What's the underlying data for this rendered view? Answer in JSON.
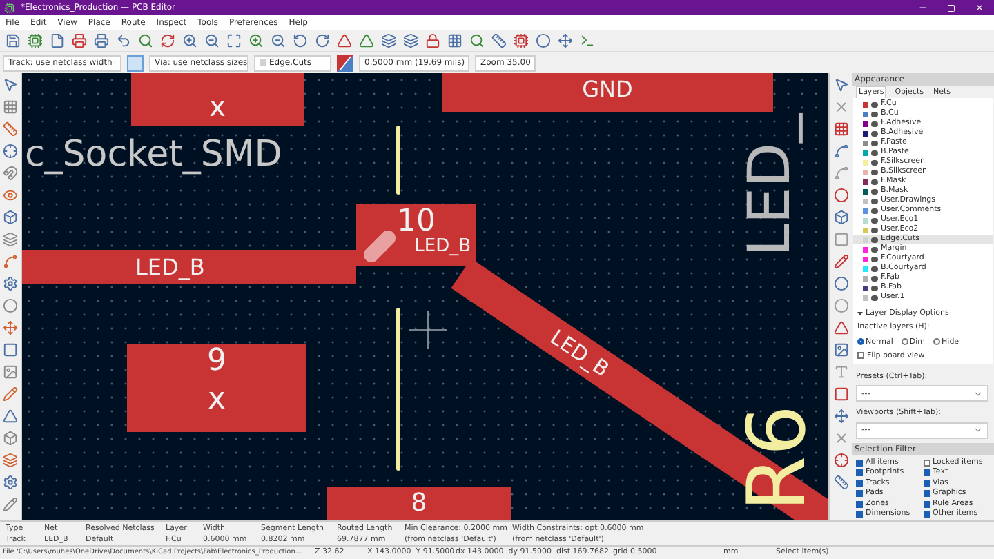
{
  "window": {
    "title": "*Electronics_Production — PCB Editor"
  },
  "menu": [
    "File",
    "Edit",
    "View",
    "Place",
    "Route",
    "Inspect",
    "Tools",
    "Preferences",
    "Help"
  ],
  "options_bar": {
    "track_width": "Track: use netclass width",
    "via_size": "Via: use netclass sizes",
    "layer": "Edge.Cuts",
    "grid": "0.5000 mm (19.69 mils)",
    "zoom": "Zoom 35.00"
  },
  "canvas": {
    "footprint_text": "c_Socket_SMD",
    "pads": [
      {
        "label": "x"
      },
      {
        "label": "GND"
      },
      {
        "label": "10",
        "net": "LED_B"
      },
      {
        "label": "9",
        "sublabel": "x"
      },
      {
        "label": "8"
      }
    ],
    "tracks": [
      {
        "net": "LED_B"
      },
      {
        "net": "LED_B"
      }
    ],
    "texts": [
      {
        "text": "LED_",
        "kind": "fab"
      },
      {
        "text": "R6",
        "kind": "silkscreen"
      }
    ]
  },
  "appearance": {
    "title": "Appearance",
    "tabs": [
      {
        "label": "Layers",
        "selected": true
      },
      {
        "label": "Objects",
        "selected": false
      },
      {
        "label": "Nets",
        "selected": false
      }
    ],
    "layers": [
      {
        "name": "F.Cu",
        "color": "#c83434",
        "selected": false
      },
      {
        "name": "B.Cu",
        "color": "#4d7fc4",
        "selected": false
      },
      {
        "name": "F.Adhesive",
        "color": "#84008a",
        "selected": false
      },
      {
        "name": "B.Adhesive",
        "color": "#1a1a7a",
        "selected": false
      },
      {
        "name": "F.Paste",
        "color": "#8c8c8c",
        "selected": false
      },
      {
        "name": "B.Paste",
        "color": "#00a8a8",
        "selected": false
      },
      {
        "name": "F.Silkscreen",
        "color": "#f2eda1",
        "selected": false
      },
      {
        "name": "B.Silkscreen",
        "color": "#e8b2a7",
        "selected": false
      },
      {
        "name": "F.Mask",
        "color": "#842b5c",
        "selected": false
      },
      {
        "name": "B.Mask",
        "color": "#025c5c",
        "selected": false
      },
      {
        "name": "User.Drawings",
        "color": "#c2c2c2",
        "selected": false
      },
      {
        "name": "User.Comments",
        "color": "#5994dc",
        "selected": false
      },
      {
        "name": "User.Eco1",
        "color": "#b5dbd2",
        "selected": false
      },
      {
        "name": "User.Eco2",
        "color": "#d8c852",
        "selected": false
      },
      {
        "name": "Edge.Cuts",
        "color": "#d0d2cd",
        "selected": true
      },
      {
        "name": "Margin",
        "color": "#ff26e2",
        "selected": false
      },
      {
        "name": "F.Courtyard",
        "color": "#ff26e2",
        "selected": false
      },
      {
        "name": "B.Courtyard",
        "color": "#26e9ff",
        "selected": false
      },
      {
        "name": "F.Fab",
        "color": "#afafaf",
        "selected": false
      },
      {
        "name": "B.Fab",
        "color": "#424280",
        "selected": false
      },
      {
        "name": "User.1",
        "color": "#c2c2c2",
        "selected": false
      }
    ],
    "display_options": {
      "header": "Layer Display Options",
      "expanded": true,
      "inactive_label": "Inactive layers (H):",
      "modes": [
        {
          "label": "Normal",
          "selected": true
        },
        {
          "label": "Dim",
          "selected": false
        },
        {
          "label": "Hide",
          "selected": false
        }
      ],
      "flip": {
        "label": "Flip board view",
        "checked": false
      }
    },
    "presets": {
      "label": "Presets (Ctrl+Tab):",
      "value": "---"
    },
    "viewports": {
      "label": "Viewports (Shift+Tab):",
      "value": "---"
    }
  },
  "selection_filter": {
    "title": "Selection Filter",
    "items": [
      {
        "label": "All items",
        "checked": true
      },
      {
        "label": "Locked items",
        "checked": false
      },
      {
        "label": "Footprints",
        "checked": true
      },
      {
        "label": "Text",
        "checked": true
      },
      {
        "label": "Tracks",
        "checked": true
      },
      {
        "label": "Vias",
        "checked": true
      },
      {
        "label": "Pads",
        "checked": true
      },
      {
        "label": "Graphics",
        "checked": true
      },
      {
        "label": "Zones",
        "checked": true
      },
      {
        "label": "Rule Areas",
        "checked": true
      },
      {
        "label": "Dimensions",
        "checked": true
      },
      {
        "label": "Other items",
        "checked": true
      }
    ]
  },
  "message_panel": [
    {
      "label": "Type",
      "value": "Track"
    },
    {
      "label": "Net",
      "value": "LED_B"
    },
    {
      "label": "Resolved Netclass",
      "value": "Default"
    },
    {
      "label": "Layer",
      "value": "F.Cu"
    },
    {
      "label": "Width",
      "value": "0.6000 mm"
    },
    {
      "label": "Segment Length",
      "value": "0.8202 mm"
    },
    {
      "label": "Routed Length",
      "value": "69.7877 mm"
    },
    {
      "label": "Min Clearance: 0.2000 mm",
      "value": "(from netclass 'Default')"
    },
    {
      "label": "Width Constraints: opt 0.6000 mm",
      "value": "(from netclass 'Default')"
    }
  ],
  "status_bar": [
    "File 'C:\\Users\\muhes\\OneDrive\\Documents\\KiCad Projects\\Fab\\Electronics_Production...",
    "Z 32.62",
    "X 143.0000  Y 91.5000",
    "dx 143.0000  dy 91.5000  dist 169.7682",
    "grid 0.5000",
    "mm",
    "Select item(s)"
  ]
}
